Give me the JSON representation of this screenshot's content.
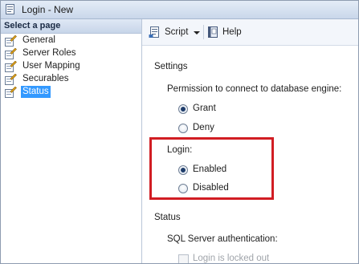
{
  "window": {
    "title": "Login - New",
    "app_icon": "document-icon"
  },
  "left_pane": {
    "header": "Select a page",
    "pages": [
      {
        "label": "General",
        "icon": "page-wrench-icon",
        "selected": false
      },
      {
        "label": "Server Roles",
        "icon": "page-wrench-icon",
        "selected": false
      },
      {
        "label": "User Mapping",
        "icon": "page-wrench-icon",
        "selected": false
      },
      {
        "label": "Securables",
        "icon": "page-wrench-icon",
        "selected": false
      },
      {
        "label": "Status",
        "icon": "page-wrench-icon",
        "selected": true
      }
    ]
  },
  "toolbar": {
    "script_label": "Script",
    "script_icon": "script-icon",
    "help_label": "Help",
    "help_icon": "help-book-icon"
  },
  "settings": {
    "section_label": "Settings",
    "permission_label": "Permission to connect to database engine:",
    "permission_options": [
      {
        "label": "Grant",
        "checked": true
      },
      {
        "label": "Deny",
        "checked": false
      }
    ],
    "login_label": "Login:",
    "login_options": [
      {
        "label": "Enabled",
        "checked": true
      },
      {
        "label": "Disabled",
        "checked": false
      }
    ]
  },
  "status": {
    "section_label": "Status",
    "sql_auth_label": "SQL Server authentication:",
    "locked_out_label": "Login is locked out",
    "locked_out_checked": false
  },
  "colors": {
    "selection": "#3399ff",
    "highlight_border": "#d11d23"
  }
}
